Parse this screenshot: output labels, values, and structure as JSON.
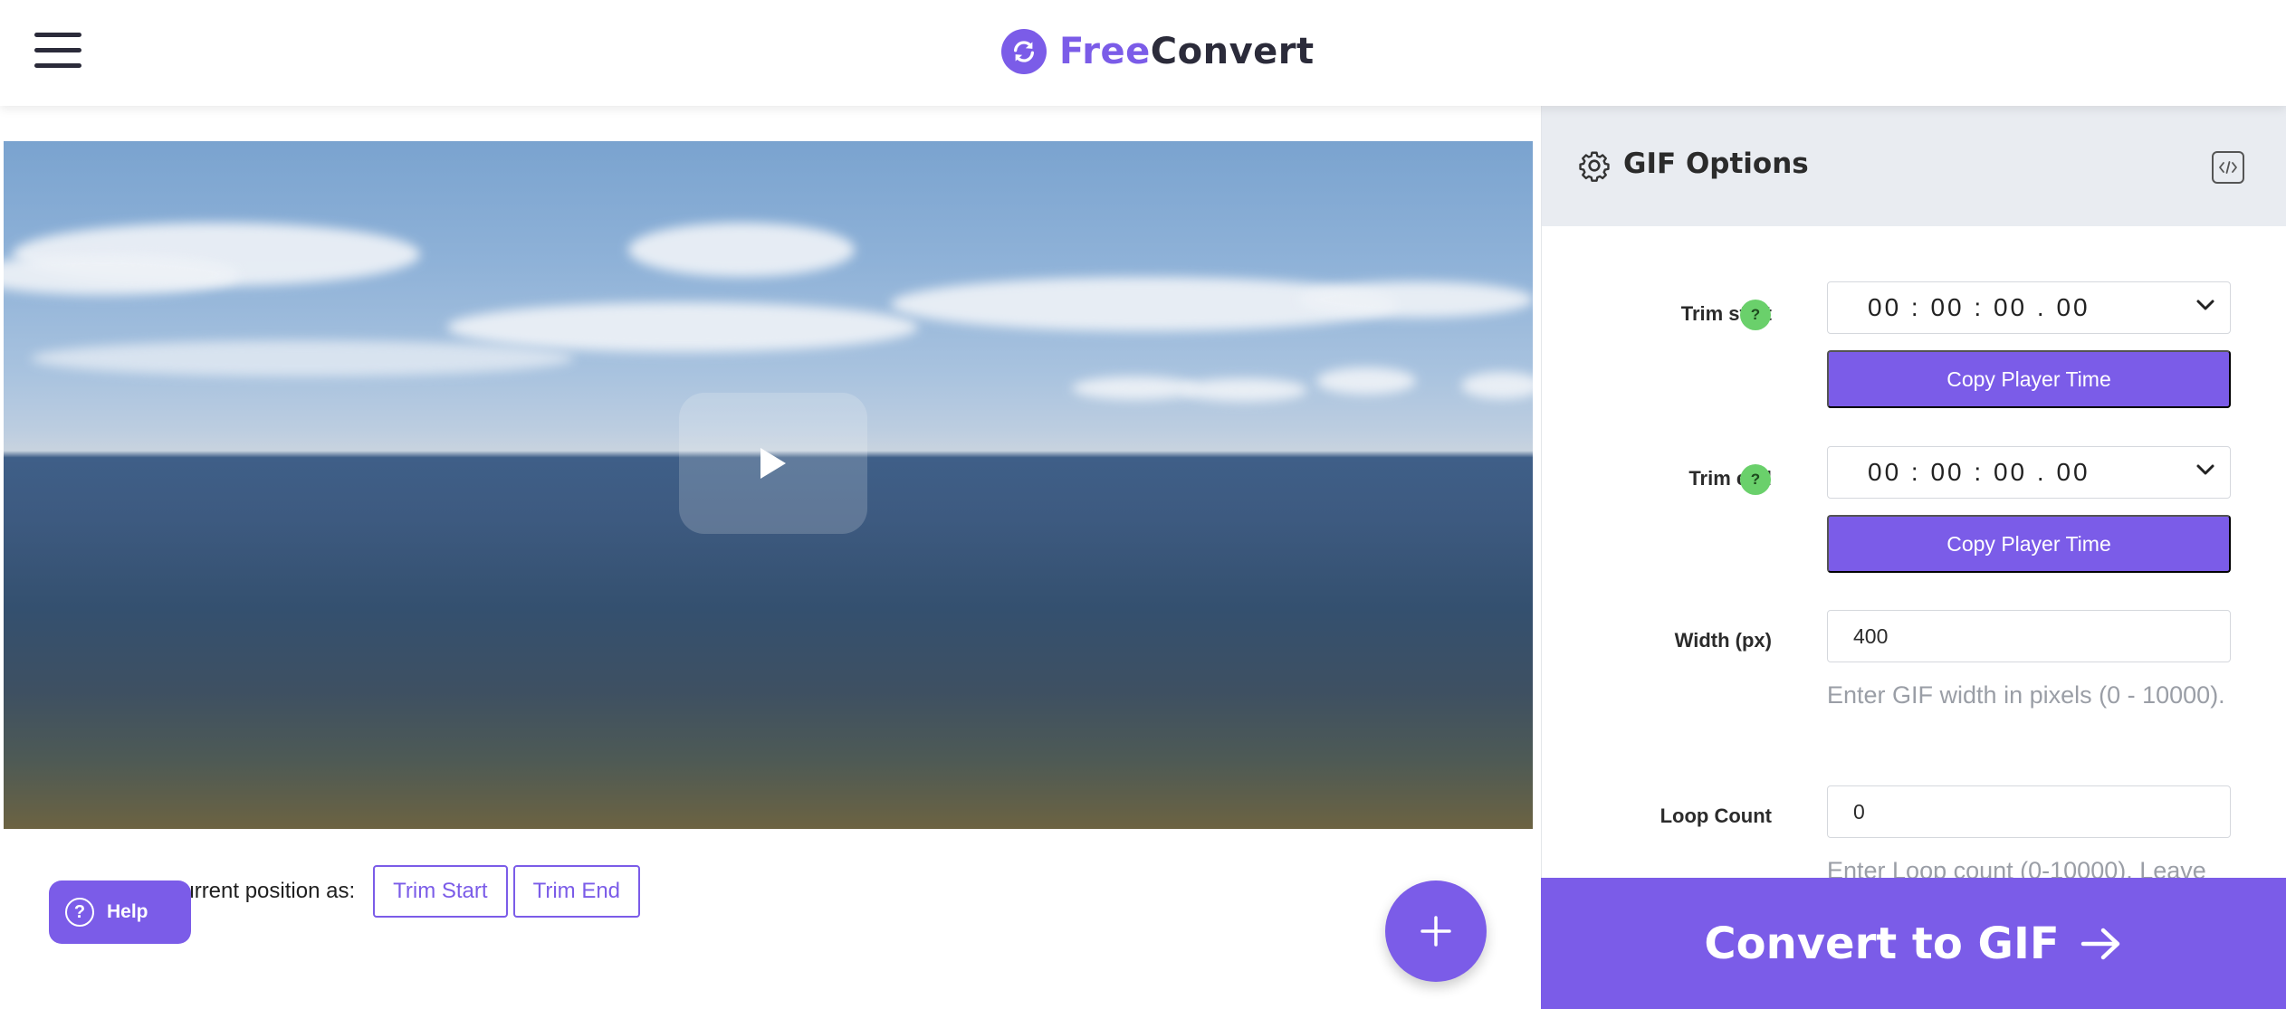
{
  "header": {
    "logo_free": "Free",
    "logo_convert": "Convert"
  },
  "player": {
    "position_label": "Use current position as:",
    "trim_start_button": "Trim Start",
    "trim_end_button": "Trim End"
  },
  "help": {
    "label": "Help",
    "icon_glyph": "?"
  },
  "panel": {
    "title": "GIF Options",
    "trim_start": {
      "label": "Trim start",
      "value": "00 : 00 : 00 . 00",
      "copy_label": "Copy Player Time",
      "help_glyph": "?"
    },
    "trim_end": {
      "label": "Trim end",
      "value": "00 : 00 : 00 . 00",
      "copy_label": "Copy Player Time",
      "help_glyph": "?"
    },
    "width": {
      "label": "Width (px)",
      "value": "400",
      "hint": "Enter GIF width in pixels (0 - 10000)."
    },
    "loop": {
      "label": "Loop Count",
      "value": "0",
      "hint": "Enter Loop count (0-10000). Leave"
    }
  },
  "convert": {
    "label": "Convert to GIF"
  },
  "colors": {
    "accent": "#7b5ce8",
    "help_badge": "#6ad06b",
    "panel_header": "#e9ecf1"
  },
  "icons": [
    "hamburger-icon",
    "logo-refresh-icon",
    "play-icon",
    "help-icon",
    "plus-icon",
    "gear-icon",
    "embed-code-icon",
    "chevron-down-icon",
    "arrow-right-icon"
  ]
}
